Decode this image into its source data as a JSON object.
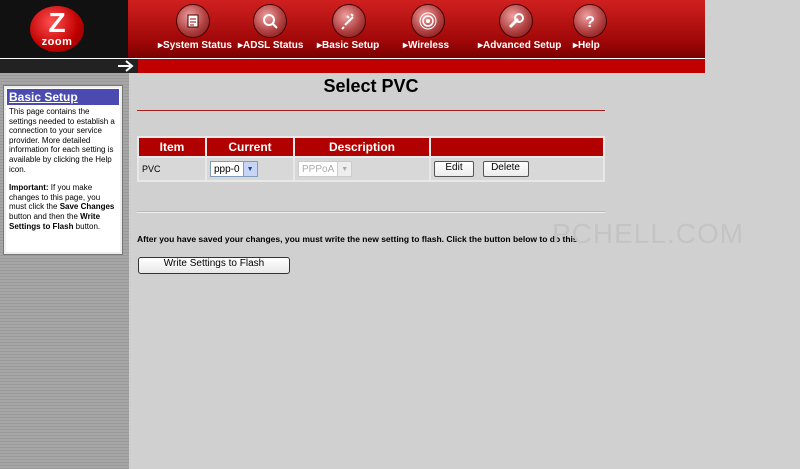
{
  "brand": {
    "logo_letter": "Z",
    "logo_word": "zoom"
  },
  "nav": [
    {
      "label": "System Status",
      "icon": "status-icon"
    },
    {
      "label": "ADSL Status",
      "icon": "magnifier-icon"
    },
    {
      "label": "Basic Setup",
      "icon": "plug-icon"
    },
    {
      "label": "Wireless",
      "icon": "wireless-icon"
    },
    {
      "label": "Advanced Setup",
      "icon": "wrench-icon"
    },
    {
      "label": "Help",
      "icon": "question-icon"
    }
  ],
  "sidebar": {
    "title": "Basic Setup",
    "paragraph1": "This page contains the settings needed to establish a connection to your service provider. More detailed information for each setting is available by clicking the Help icon.",
    "important_label": "Important:",
    "important_text_1": " If you make changes to this page, you must click the ",
    "important_bold_1": "Save Changes",
    "important_text_2": " button and then the ",
    "important_bold_2": "Write Settings to Flash",
    "important_text_3": " button."
  },
  "page": {
    "title": "Select PVC",
    "table": {
      "headers": [
        "Item",
        "Current",
        "Description",
        ""
      ],
      "row": {
        "item": "PVC",
        "current": "ppp-0",
        "description": "PPPoA",
        "edit_label": "Edit",
        "delete_label": "Delete"
      }
    },
    "notice": "After you have saved your changes, you must write the new setting to flash. Click the button below to do this.",
    "flash_button": "Write Settings to Flash"
  },
  "watermark": "PCHELL.COM",
  "colors": {
    "header_red": "#c00000",
    "sidebar_title_bg": "#4a4ab0"
  }
}
